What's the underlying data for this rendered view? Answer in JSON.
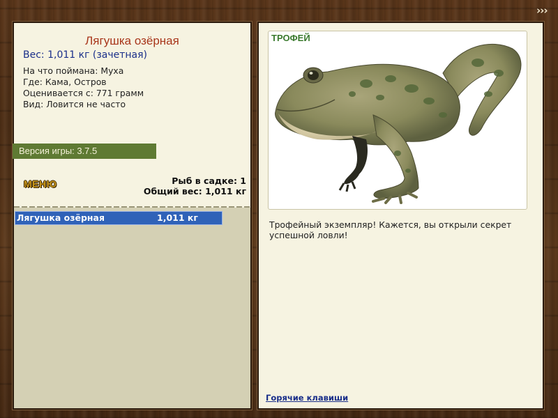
{
  "nav": {
    "more_label": "›››"
  },
  "catch": {
    "title": "Лягушка озёрная",
    "weight_line": "Вес: 1,011 кг (зачетная)",
    "details": [
      "На что поймана: Муха",
      "Где: Кама, Остров",
      "Оценивается с: 771 грамм",
      "Вид: Ловится не часто"
    ]
  },
  "version_label": "Версия игры: 3.7.5",
  "menu_label": "МЕНЮ",
  "stats": {
    "fish_count": "Рыб в садке: 1",
    "total_weight": "Общий вес: 1,011 кг"
  },
  "keepnet": {
    "items": [
      {
        "name": "Лягушка озёрная",
        "weight": "1,011 кг",
        "selected": true
      }
    ]
  },
  "trophy": {
    "badge": "ТРОФЕЙ",
    "image_icon": "frog-illustration",
    "description": "Трофейный экземпляр! Кажется, вы открыли секрет успешной ловли!"
  },
  "hotkeys_link": "Горячие клавиши",
  "colors": {
    "title": "#a8361b",
    "weight": "#1a2f8a",
    "version_bar": "#5f7a33",
    "selection": "#2f62b8",
    "trophy_badge": "#3b7a2e"
  }
}
